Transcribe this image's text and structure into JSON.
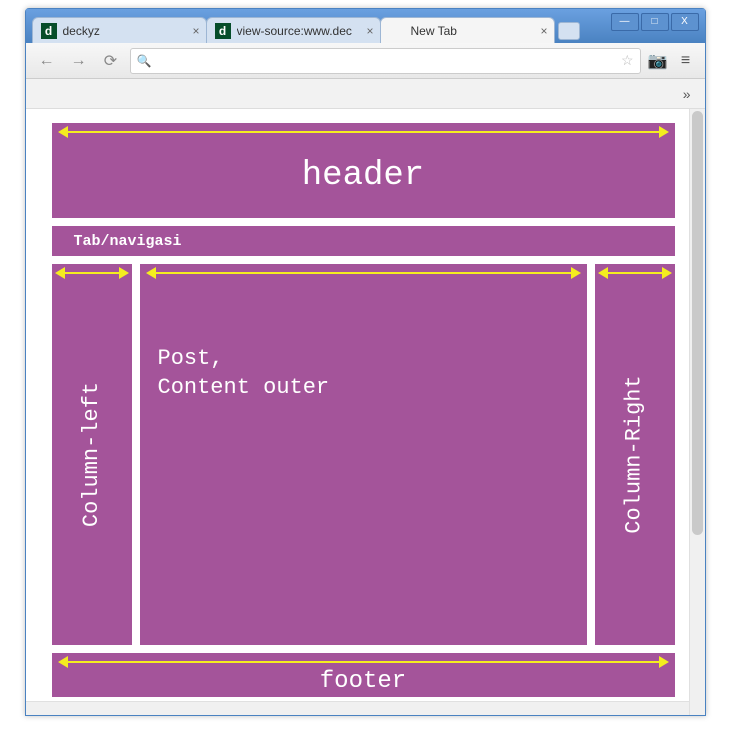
{
  "browser": {
    "tabs": [
      {
        "title": "deckyz",
        "favicon_letter": "d",
        "active": false
      },
      {
        "title": "view-source:www.dec",
        "favicon_letter": "d",
        "active": false
      },
      {
        "title": "New Tab",
        "favicon_letter": "",
        "active": true
      }
    ],
    "omnibox_value": "",
    "window_controls": {
      "min": "—",
      "max": "□",
      "close": "X"
    },
    "overflow": "»"
  },
  "layout": {
    "header": "header",
    "nav": "Tab/navigasi",
    "col_left": "Column-left",
    "content": "Post,\nContent outer",
    "col_right": "Column-Right",
    "footer": "footer"
  },
  "colors": {
    "block_bg": "#a4549a",
    "arrow": "#f4ed1f"
  }
}
